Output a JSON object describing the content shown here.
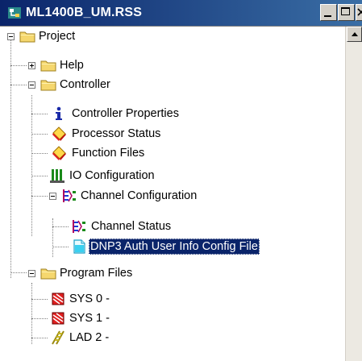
{
  "window": {
    "title": "ML1400B_UM.RSS",
    "app_icon": "project-tree-icon"
  },
  "tree": {
    "project": {
      "label": "Project",
      "icon": "folder-icon",
      "expanded": true
    },
    "help": {
      "label": "Help",
      "icon": "folder-icon",
      "expanded": false
    },
    "controller": {
      "label": "Controller",
      "icon": "folder-icon",
      "expanded": true
    },
    "controller_properties": {
      "label": "Controller Properties",
      "icon": "info-icon"
    },
    "processor_status": {
      "label": "Processor Status",
      "icon": "status-file-icon"
    },
    "function_files": {
      "label": "Function Files",
      "icon": "status-file-icon"
    },
    "io_configuration": {
      "label": "IO Configuration",
      "icon": "io-rack-icon"
    },
    "channel_configuration": {
      "label": "Channel Configuration",
      "icon": "channel-icon",
      "expanded": true
    },
    "channel_status": {
      "label": "Channel Status",
      "icon": "channel-icon"
    },
    "dnp3_auth": {
      "label": "DNP3 Auth User Info Config File",
      "icon": "document-icon",
      "selected": true
    },
    "program_files": {
      "label": "Program Files",
      "icon": "folder-icon",
      "expanded": true
    },
    "sys0": {
      "label": "SYS 0 -",
      "icon": "system-program-icon"
    },
    "sys1": {
      "label": "SYS 1 -",
      "icon": "system-program-icon"
    },
    "lad2": {
      "label": "LAD 2 -",
      "icon": "ladder-program-icon"
    }
  },
  "colors": {
    "titlebar_start": "#0a246a",
    "titlebar_end": "#3a6ea5",
    "selection": "#0a246a",
    "folder": "#f5d76e"
  }
}
